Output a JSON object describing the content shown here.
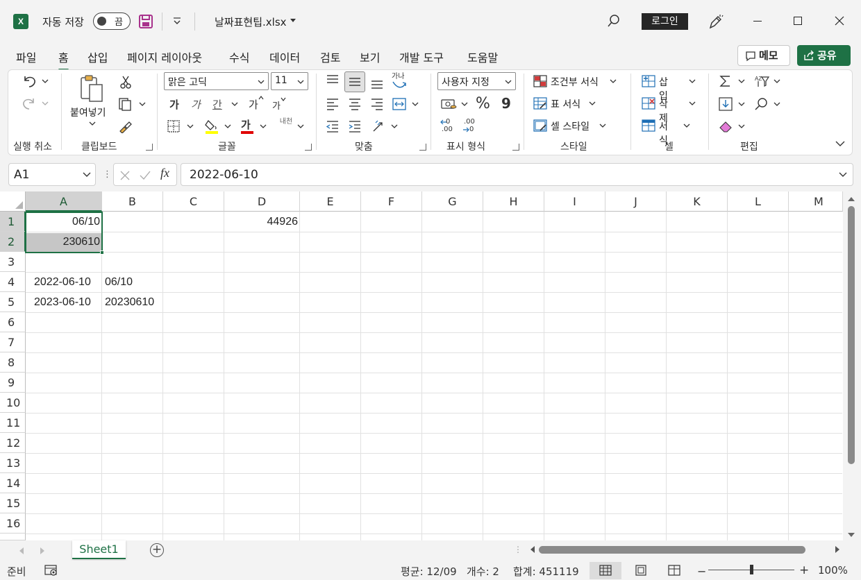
{
  "titlebar": {
    "autosave_label": "자동 저장",
    "autosave_state": "끔",
    "filename": "날짜표현팁.xlsx",
    "login_label": "로그인"
  },
  "ribbon_tabs": [
    "파일",
    "홈",
    "삽입",
    "페이지 레이아웃",
    "수식",
    "데이터",
    "검토",
    "보기",
    "개발 도구",
    "도움말"
  ],
  "active_tab": "홈",
  "memo_label": "메모",
  "share_label": "공유",
  "ribbon": {
    "undo_group": "실행 취소",
    "clipboard_group": "클립보드",
    "paste_label": "붙여넣기",
    "font_group": "글꼴",
    "font_name": "맑은 고딕",
    "font_size": "11",
    "bold": "가",
    "italic": "가",
    "underline": "간",
    "grow": "가",
    "shrink": "가",
    "font_color": "가",
    "phonetic": "내천",
    "align_group": "맞춤",
    "wrap_glyph": "가나",
    "number_group": "표시 형식",
    "number_format": "사용자 지정",
    "percent": "%",
    "comma": "9",
    "dec_inc": ".00",
    "dec_dec": ".00",
    "styles_group": "스타일",
    "cond_format": "조건부 서식",
    "table_format": "표 서식",
    "cell_style": "셀 스타일",
    "cells_group": "셀",
    "insert": "삽입",
    "delete": "삭제",
    "format": "서식",
    "edit_group": "편집"
  },
  "formula_bar": {
    "name_box": "A1",
    "formula": "2022-06-10"
  },
  "columns": [
    "A",
    "B",
    "C",
    "D",
    "E",
    "F",
    "G",
    "H",
    "I",
    "J",
    "K",
    "L",
    "M"
  ],
  "rows": [
    "1",
    "2",
    "3",
    "4",
    "5",
    "6",
    "7",
    "8",
    "9",
    "10",
    "11",
    "12",
    "13",
    "14",
    "15",
    "16"
  ],
  "cells": {
    "A1": "06/10",
    "D1": "44926",
    "A2": "230610",
    "A4": "2022-06-10",
    "B4": "06/10",
    "A5": "2023-06-10",
    "B5": "20230610"
  },
  "sheet_tab": "Sheet1",
  "status": {
    "ready": "준비",
    "average": "평균: 12/09",
    "count": "개수: 2",
    "sum": "합계: 451119",
    "zoom": "100%"
  },
  "colors": {
    "accent": "#1e7145",
    "selection_fill": "#c6c6c6"
  }
}
